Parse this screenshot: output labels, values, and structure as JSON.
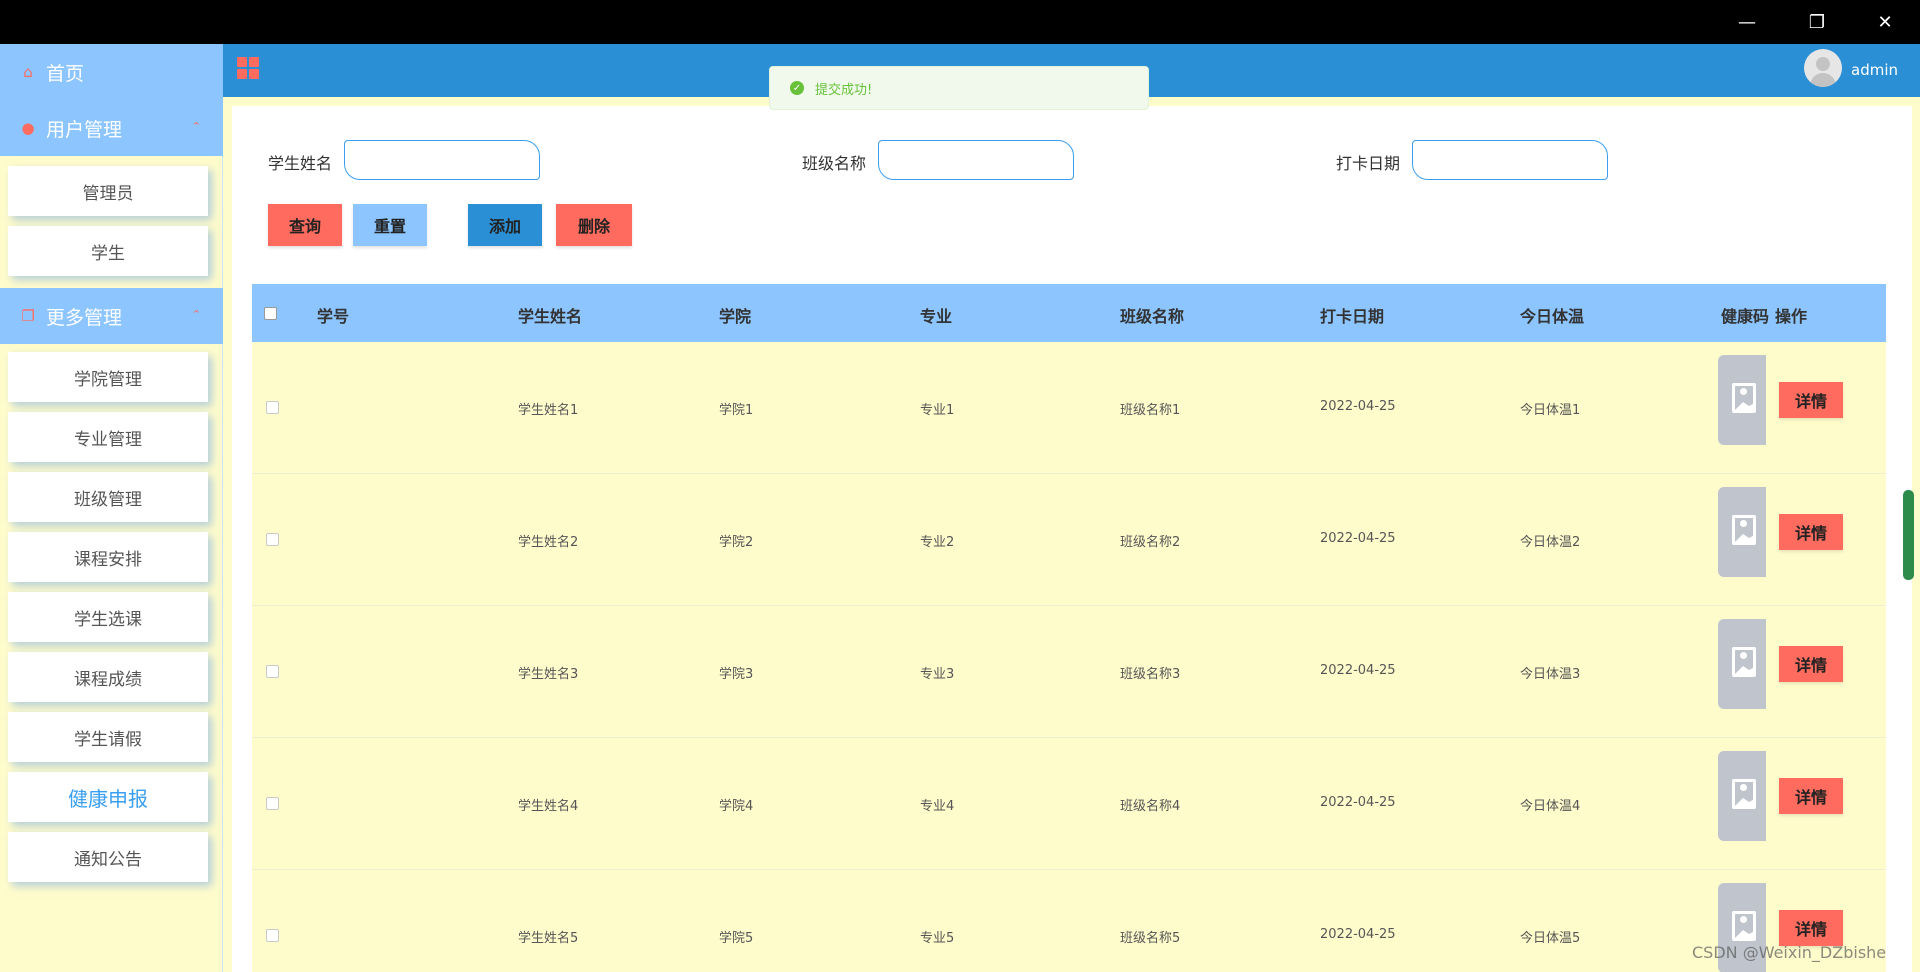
{
  "window": {
    "minimize_icon": "minimize-icon",
    "restore_icon": "restore-icon",
    "close_icon": "close-icon"
  },
  "sidebar": {
    "home": "首页",
    "group_user": "用户管理",
    "group_more": "更多管理",
    "user_items": [
      "管理员",
      "学生"
    ],
    "more_items": [
      "学院管理",
      "专业管理",
      "班级管理",
      "课程安排",
      "学生选课",
      "课程成绩",
      "学生请假",
      "健康申报",
      "通知公告"
    ],
    "active_item": "健康申报"
  },
  "header": {
    "user": "admin"
  },
  "toast": {
    "message": "提交成功!"
  },
  "search": {
    "name_label": "学生姓名",
    "class_label": "班级名称",
    "date_label": "打卡日期"
  },
  "buttons": {
    "query": "查询",
    "reset": "重置",
    "add": "添加",
    "delete": "删除",
    "detail": "详情"
  },
  "table": {
    "columns": [
      "学号",
      "学生姓名",
      "学院",
      "专业",
      "班级名称",
      "打卡日期",
      "今日体温",
      "健康码",
      "操作"
    ],
    "rows": [
      {
        "id": "",
        "name": "学生姓名1",
        "college": "学院1",
        "major": "专业1",
        "class": "班级名称1",
        "date": "2022-04-25",
        "temp": "今日体温1"
      },
      {
        "id": "",
        "name": "学生姓名2",
        "college": "学院2",
        "major": "专业2",
        "class": "班级名称2",
        "date": "2022-04-25",
        "temp": "今日体温2"
      },
      {
        "id": "",
        "name": "学生姓名3",
        "college": "学院3",
        "major": "专业3",
        "class": "班级名称3",
        "date": "2022-04-25",
        "temp": "今日体温3"
      },
      {
        "id": "",
        "name": "学生姓名4",
        "college": "学院4",
        "major": "专业4",
        "class": "班级名称4",
        "date": "2022-04-25",
        "temp": "今日体温4"
      },
      {
        "id": "",
        "name": "学生姓名5",
        "college": "学院5",
        "major": "专业5",
        "class": "班级名称5",
        "date": "2022-04-25",
        "temp": "今日体温5"
      }
    ]
  },
  "watermark": "CSDN @Weixin_DZbishe",
  "colors": {
    "primary": "#2a8fd4",
    "light": "#8cc5ff",
    "accent": "#ff6b5e",
    "row_bg": "#fffccc"
  }
}
